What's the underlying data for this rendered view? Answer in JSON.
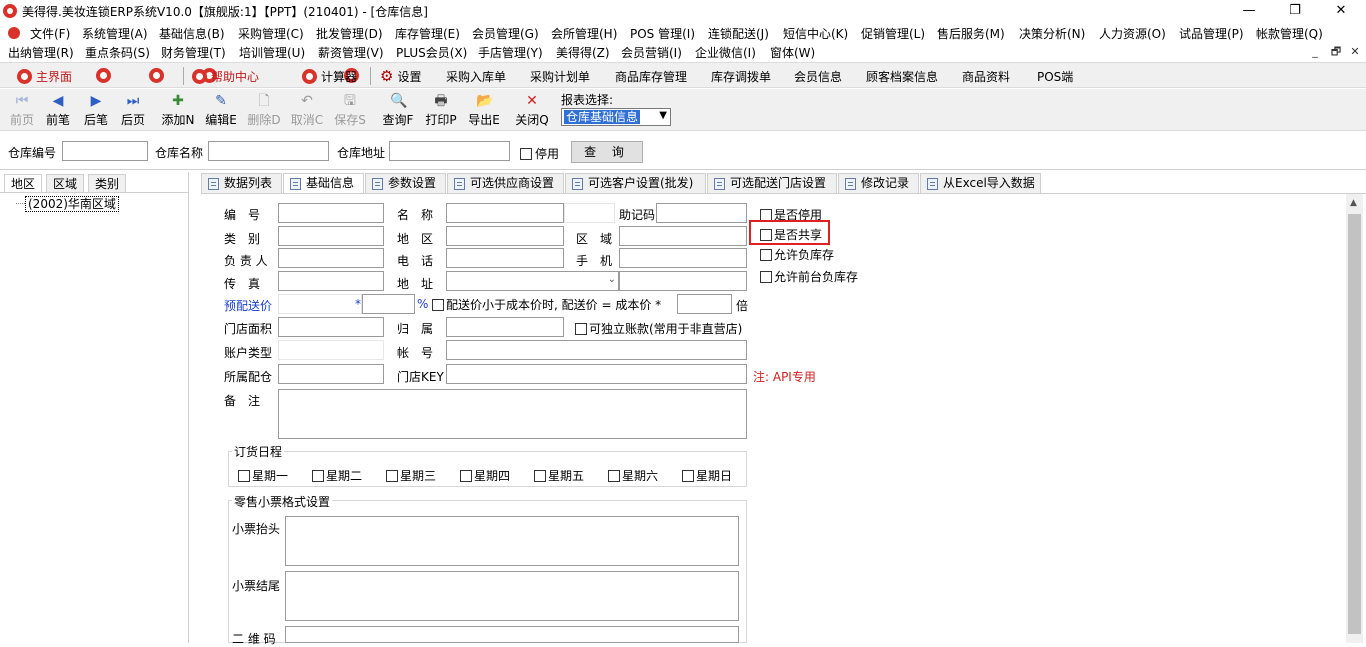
{
  "window": {
    "title": "美得得.美妆连锁ERP系统V10.0【旗舰版:1】【PPT】(210401) - [仓库信息]",
    "minimize": "—",
    "restore": "❐",
    "close": "✕"
  },
  "menu_row1": [
    "文件(F)",
    "系统管理(A)",
    "基础信息(B)",
    "采购管理(C)",
    "批发管理(D)",
    "库存管理(E)",
    "会员管理(G)",
    "会所管理(H)",
    "POS 管理(I)",
    "连锁配送(J)",
    "短信中心(K)",
    "促销管理(L)",
    "售后服务(M)",
    "决策分析(N)",
    "人力资源(O)",
    "试品管理(P)",
    "帐款管理(Q)"
  ],
  "menu_row2": [
    "出纳管理(R)",
    "重点条码(S)",
    "财务管理(T)",
    "培训管理(U)",
    "薪资管理(V)",
    "PLUS会员(X)",
    "手店管理(Y)",
    "美得得(Z)",
    "会员营销(I)",
    "企业微信(I)",
    "窗体(W)"
  ],
  "mdi_buttons": [
    "_",
    "🗗",
    "✕"
  ],
  "quickbar": {
    "home": "主界面",
    "help": "帮助中心",
    "calculator": "计算器",
    "settings": "设置",
    "links": [
      "采购入库单",
      "采购计划单",
      "商品库存管理",
      "库存调拨单",
      "会员信息",
      "顾客档案信息",
      "商品资料",
      "POS端"
    ]
  },
  "toolbar": {
    "first": "前页",
    "prev": "前笔",
    "next": "后笔",
    "last": "后页",
    "add": "添加N",
    "edit": "编辑E",
    "delete": "删除D",
    "cancel": "取消C",
    "save": "保存S",
    "query": "查询F",
    "print": "打印P",
    "export": "导出E",
    "close": "关闭Q",
    "report_label": "报表选择:",
    "report_value": "仓库基础信息"
  },
  "search": {
    "code_label": "仓库编号",
    "name_label": "仓库名称",
    "address_label": "仓库地址",
    "disabled_label": "停用",
    "query_button": "查 询"
  },
  "left": {
    "tabs": [
      "地区",
      "区域",
      "类别"
    ],
    "tree_item": "(2002)华南区域"
  },
  "tabs": [
    "数据列表",
    "基础信息",
    "参数设置",
    "可选供应商设置",
    "可选客户设置(批发)",
    "可选配送门店设置",
    "修改记录",
    "从Excel导入数据"
  ],
  "form": {
    "code": "编　号",
    "name": "名　称",
    "mnemonic": "助记码",
    "category": "类　别",
    "region": "地　区",
    "area": "区　域",
    "manager": "负 责 人",
    "phone": "电　话",
    "mobile": "手　机",
    "fax": "传　真",
    "address": "地　址",
    "pre_price": "预配送价",
    "star1": "*",
    "percent": "%",
    "cost_rule": "配送价小于成本价时, 配送价 = 成本价 *",
    "times": "倍",
    "store_area": "门店面积",
    "belong": "归　属",
    "independent": "可独立账款(常用于非直营店)",
    "account_type": "账户类型",
    "account_no": "帐　号",
    "warehouse": "所属配仓",
    "store_key": "门店KEY",
    "api_note": "注: API专用",
    "remark": "备　注",
    "opt_disabled": "是否停用",
    "opt_shared": "是否共享",
    "opt_negative": "允许负库存",
    "opt_front_negative": "允许前台负库存"
  },
  "order_schedule": {
    "title": "订货日程",
    "days": [
      "星期一",
      "星期二",
      "星期三",
      "星期四",
      "星期五",
      "星期六",
      "星期日"
    ]
  },
  "receipt": {
    "title": "零售小票格式设置",
    "header": "小票抬头",
    "footer": "小票结尾",
    "qrcode": "二 维 码"
  }
}
